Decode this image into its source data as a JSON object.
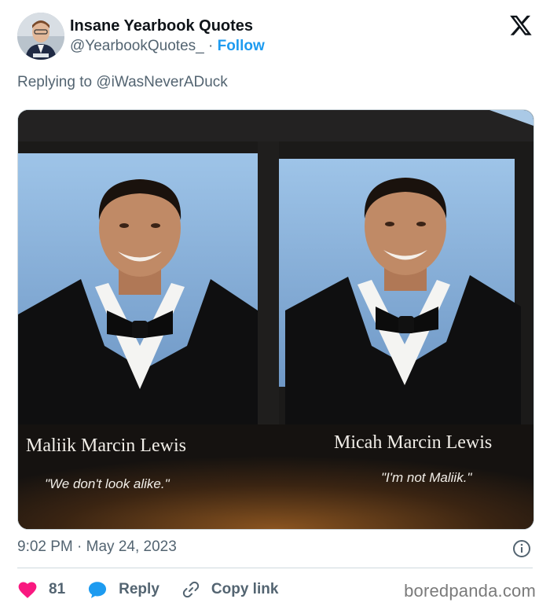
{
  "author": {
    "display_name": "Insane Yearbook Quotes",
    "handle": "@YearbookQuotes_",
    "separator": "·",
    "follow_label": "Follow"
  },
  "reply_context": {
    "prefix": "Replying to",
    "mention": "@iWasNeverADuck"
  },
  "media": {
    "left": {
      "name": "Maliik Marcin Lewis",
      "quote": "\"We don't look alike.\""
    },
    "right": {
      "name": "Micah Marcin Lewis",
      "quote": "\"I'm not Maliik.\""
    }
  },
  "timestamp": "9:02 PM · May 24, 2023",
  "actions": {
    "like_count": "81",
    "reply_label": "Reply",
    "copy_link_label": "Copy link"
  },
  "watermark": "boredpanda.com",
  "colors": {
    "accent": "#1d9bf0",
    "like": "#f91880",
    "muted": "#536471"
  },
  "icons": [
    "x-logo-icon",
    "info-icon",
    "heart-icon",
    "reply-bubble-icon",
    "link-icon"
  ]
}
